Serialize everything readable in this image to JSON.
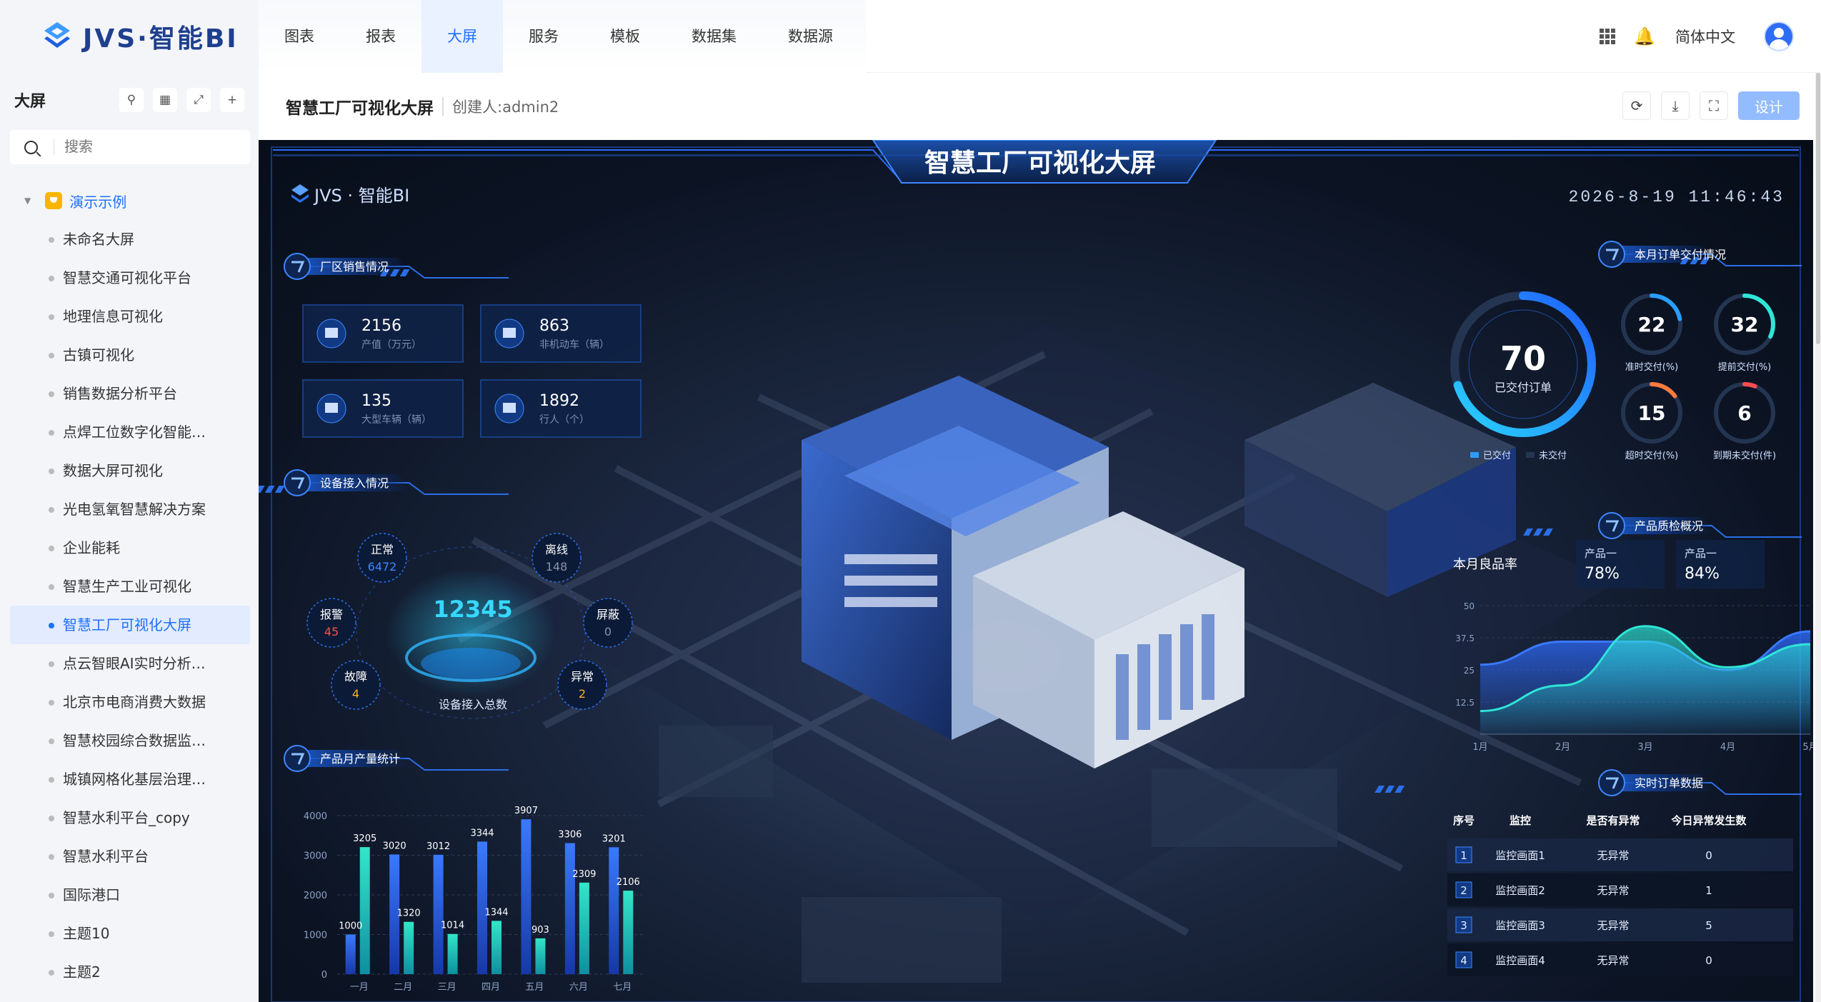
{
  "app": {
    "logo_text": "JVS·智能BI"
  },
  "nav": {
    "items": [
      "图表",
      "报表",
      "大屏",
      "服务",
      "模板",
      "数据集",
      "数据源"
    ],
    "active": "大屏"
  },
  "topright": {
    "lang": "简体中文"
  },
  "sidebar": {
    "title": "大屏",
    "search_placeholder": "搜索",
    "root": "演示示例",
    "items": [
      "未命名大屏",
      "智慧交通可视化平台",
      "地理信息可视化",
      "古镇可视化",
      "销售数据分析平台",
      "点焊工位数字化智能…",
      "数据大屏可视化",
      "光电氢氧智慧解决方案",
      "企业能耗",
      "智慧生产工业可视化",
      "智慧工厂可视化大屏",
      "点云智眼AI实时分析…",
      "北京市电商消费大数据",
      "智慧校园综合数据监…",
      "城镇网格化基层治理…",
      "智慧水利平台_copy",
      "智慧水利平台",
      "国际港口",
      "主题10",
      "主题2"
    ],
    "active": "智慧工厂可视化大屏"
  },
  "content": {
    "title": "智慧工厂可视化大屏",
    "creator": "创建人:admin2",
    "design_label": "设计"
  },
  "screen": {
    "title": "智慧工厂可视化大屏",
    "brand": "JVS · 智能BI",
    "datetime": "2026-8-19  11:46:43",
    "sales": {
      "title": "厂区销售情况",
      "cards": [
        {
          "value": "2156",
          "label": "产值（万元）"
        },
        {
          "value": "863",
          "label": "非机动车（辆）"
        },
        {
          "value": "135",
          "label": "大型车辆（辆）"
        },
        {
          "value": "1892",
          "label": "行人（个）"
        }
      ]
    },
    "devices": {
      "title": "设备接入情况",
      "total": "12345",
      "total_label": "设备接入总数",
      "nodes": [
        {
          "label": "正常",
          "value": "6472"
        },
        {
          "label": "离线",
          "value": "148"
        },
        {
          "label": "报警",
          "value": "45"
        },
        {
          "label": "屏蔽",
          "value": "0"
        },
        {
          "label": "故障",
          "value": "4"
        },
        {
          "label": "异常",
          "value": "2"
        }
      ]
    },
    "orders": {
      "title": "本月订单交付情况",
      "main_value": "70",
      "main_label": "已交付订单",
      "legend": [
        "已交付",
        "未交付"
      ],
      "rings": [
        {
          "value": "22",
          "label": "准时交付(%)",
          "pct": 22
        },
        {
          "value": "32",
          "label": "提前交付(%)",
          "pct": 32
        },
        {
          "value": "15",
          "label": "超时交付(%)",
          "pct": 15
        },
        {
          "value": "6",
          "label": "到期未交付(件)",
          "pct": 6
        }
      ],
      "main_pct": 70
    },
    "quality": {
      "title": "产品质检概况",
      "month_label": "本月良品率",
      "items": [
        {
          "name": "产品一",
          "value": "78%"
        },
        {
          "name": "产品一",
          "value": "84%"
        }
      ]
    },
    "realtime": {
      "title": "实时订单数据",
      "headers": [
        "序号",
        "监控",
        "是否有异常",
        "今日异常发生数"
      ],
      "rows": [
        [
          "1",
          "监控画面1",
          "无异常",
          "0"
        ],
        [
          "2",
          "监控画面2",
          "无异常",
          "1"
        ],
        [
          "3",
          "监控画面3",
          "无异常",
          "5"
        ],
        [
          "4",
          "监控画面4",
          "无异常",
          "0"
        ]
      ]
    }
  },
  "chart_data": [
    {
      "type": "bar",
      "title": "产品月产量统计",
      "categories": [
        "一月",
        "二月",
        "三月",
        "四月",
        "五月",
        "六月",
        "七月"
      ],
      "series": [
        {
          "values": [
            1000,
            3020,
            3012,
            3344,
            3907,
            3306,
            3201
          ]
        },
        {
          "values": [
            3205,
            1320,
            1014,
            1344,
            903,
            2309,
            2106
          ]
        }
      ],
      "ylim": [
        0,
        4000
      ],
      "yticks": [
        0,
        1000,
        2000,
        3000,
        4000
      ]
    },
    {
      "type": "area",
      "title": "产品质检概况",
      "categories": [
        "1月",
        "2月",
        "3月",
        "4月",
        "5月"
      ],
      "series": [
        {
          "values": [
            27,
            36,
            36,
            25,
            40
          ]
        },
        {
          "values": [
            9,
            19,
            42,
            26,
            35
          ]
        }
      ],
      "ylim": [
        0,
        50
      ],
      "yticks": [
        12.5,
        25,
        37.5,
        50
      ]
    }
  ]
}
